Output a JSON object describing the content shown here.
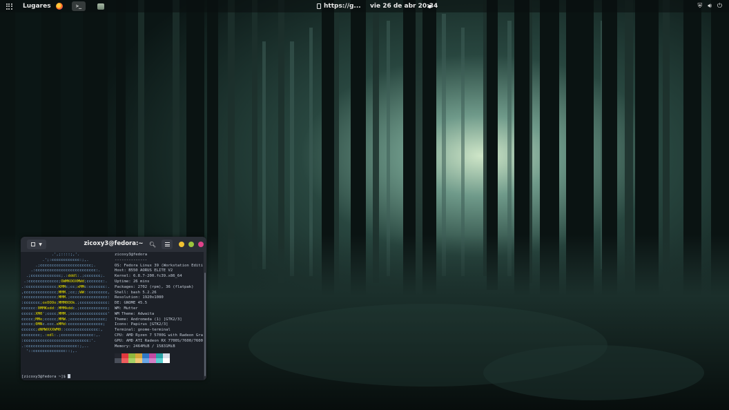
{
  "topbar": {
    "places": "Lugares",
    "browser_title": "https://g...",
    "clock": "vie 26 de abr  20:34",
    "tray": [
      "shield-icon",
      "volume-icon",
      "power-icon"
    ]
  },
  "terminal": {
    "title": "zicoxy3@fedora:~",
    "logo_lines": [
      "             .',;::::;,'.",
      "         .';:cccccccccccc:;,.",
      "      .;cccccccccccccccccccccc;.",
      "    .:cccccccccccccccccccccccccc:.",
      "  .;ccccccccccccc;.:dddl:.;ccccccc;.",
      " .:ccccccccccccc;OWMKOOXMWd;ccccccc:.",
      ".:ccccccccccccc;KMMc;cc;xMMc:ccccccc:.",
      ",cccccccccccccc;MMM.;cc;;WW::cccccccc,",
      ":cccccccccccccc;MMM.;cccccccccccccccc:",
      ":ccccccc;oxOOOo;MMM0OOk.;cccccccccccc:",
      "cccccc:0MMKxdd:;MMMkddc.;cccccccccccc;",
      "ccccc:XM0';cccc;MMM.;cccccccccccccccc'",
      "ccccc;MMo;ccccc;MMW.;ccccccccccccccc;",
      "ccccc;0MNc.ccc.xMMd:ccccccccccccccc;",
      "cccccc;dNMWXXXWM0::cccccccccccccc:,",
      "cccccccc;.:odl:.;cccccccccccccc:,.",
      ":cccccccccccccccccccccccccccc:'.",
      ".:cccccccccccccccccccccc:;,..",
      "  '::cccccccccccccc::;,."
    ],
    "info_lines": [
      "zicoxy3@fedora",
      "--------------",
      "OS: Fedora Linux 39 (Workstation Editi",
      "Host: B550 AORUS ELITE V2",
      "Kernel: 6.8.7-200.fc39.x86_64",
      "Uptime: 26 mins",
      "Packages: 2702 (rpm), 36 (flatpak)",
      "Shell: bash 5.2.26",
      "Resolution: 1920x1080",
      "DE: GNOME 45.5",
      "WM: Mutter",
      "WM Theme: Adwaita",
      "Theme: Andromeda (1) [GTK2/3]",
      "Icons: Papirus [GTK2/3]",
      "Terminal: gnome-terminal",
      "CPU: AMD Ryzen 7 5700G with Radeon Gra",
      "GPU: AMD ATI Radeon RX 7700S/7600/7600",
      "Memory: 2464MiB / 15831MiB"
    ],
    "palette_colors": [
      "#23262e",
      "#e0393e",
      "#8fb73e",
      "#d6a53a",
      "#2f78c4",
      "#c14aa0",
      "#2aa3a6",
      "#d8dee9",
      "#4a4f5a",
      "#ee5d5d",
      "#a6d166",
      "#f0c674",
      "#6aa7e6",
      "#d37fc5",
      "#5ccfd1",
      "#ffffff"
    ],
    "prompt": "[zicoxy3@fedora ~]$ "
  }
}
